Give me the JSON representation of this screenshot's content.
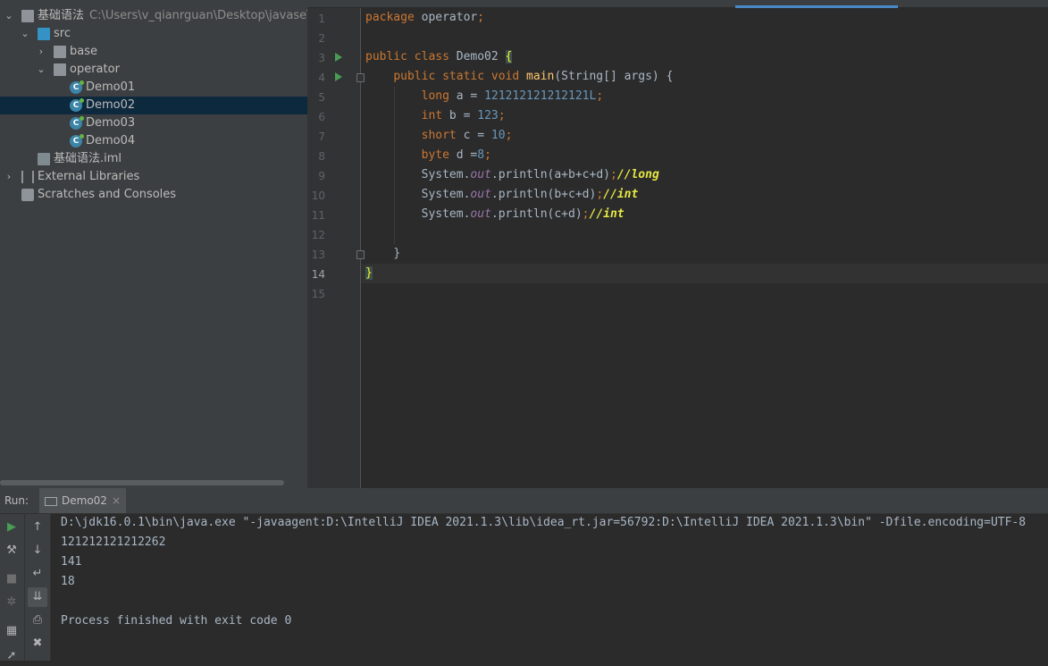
{
  "project": {
    "root_name": "基础语法",
    "root_path": "C:\\Users\\v_qianrguan\\Desktop\\javase\\基础",
    "src_label": "src",
    "packages": [
      "base",
      "operator"
    ],
    "classes": [
      "Demo01",
      "Demo02",
      "Demo03",
      "Demo04"
    ],
    "selected_class": "Demo02",
    "iml_file": "基础语法.iml",
    "external_libraries": "External Libraries",
    "scratches": "Scratches and Consoles"
  },
  "editor": {
    "line_numbers": [
      "1",
      "2",
      "3",
      "4",
      "5",
      "6",
      "7",
      "8",
      "9",
      "10",
      "11",
      "12",
      "13",
      "14",
      "15"
    ],
    "current_line": "14",
    "code": {
      "l1_kw": "package",
      "l1_rest": " operator",
      "semi": ";",
      "l3_kw": "public class",
      "l3_name": " Demo02 ",
      "l3_brace": "{",
      "l4_kw": "public static void",
      "l4_fn": "main",
      "l4_rest": "(String[] args) {",
      "l5_type": "long",
      "l5_var": " a = ",
      "l5_val": "121212121212121L",
      "l6_type": "int",
      "l6_var": " b = ",
      "l6_val": "123",
      "l7_type": "short",
      "l7_var": " c = ",
      "l7_val": "10",
      "l8_type": "byte",
      "l8_var": " d =",
      "l8_val": "8",
      "sys": "System.",
      "out": "out",
      "println": ".println",
      "l9_args": "(a+b+c+d)",
      "l9_comment": "//long",
      "l10_args": "(b+c+d)",
      "l10_comment": "//int",
      "l11_args": "(c+d)",
      "l11_comment": "//int",
      "l13": "}",
      "l14": "}"
    }
  },
  "run": {
    "label": "Run:",
    "tab_name": "Demo02",
    "tab_close": "×",
    "output": [
      "D:\\jdk16.0.1\\bin\\java.exe \"-javaagent:D:\\IntelliJ IDEA 2021.1.3\\lib\\idea_rt.jar=56792:D:\\IntelliJ IDEA 2021.1.3\\bin\" -Dfile.encoding=UTF-8",
      "121212121212262",
      "141",
      "18",
      "",
      "Process finished with exit code 0"
    ]
  }
}
